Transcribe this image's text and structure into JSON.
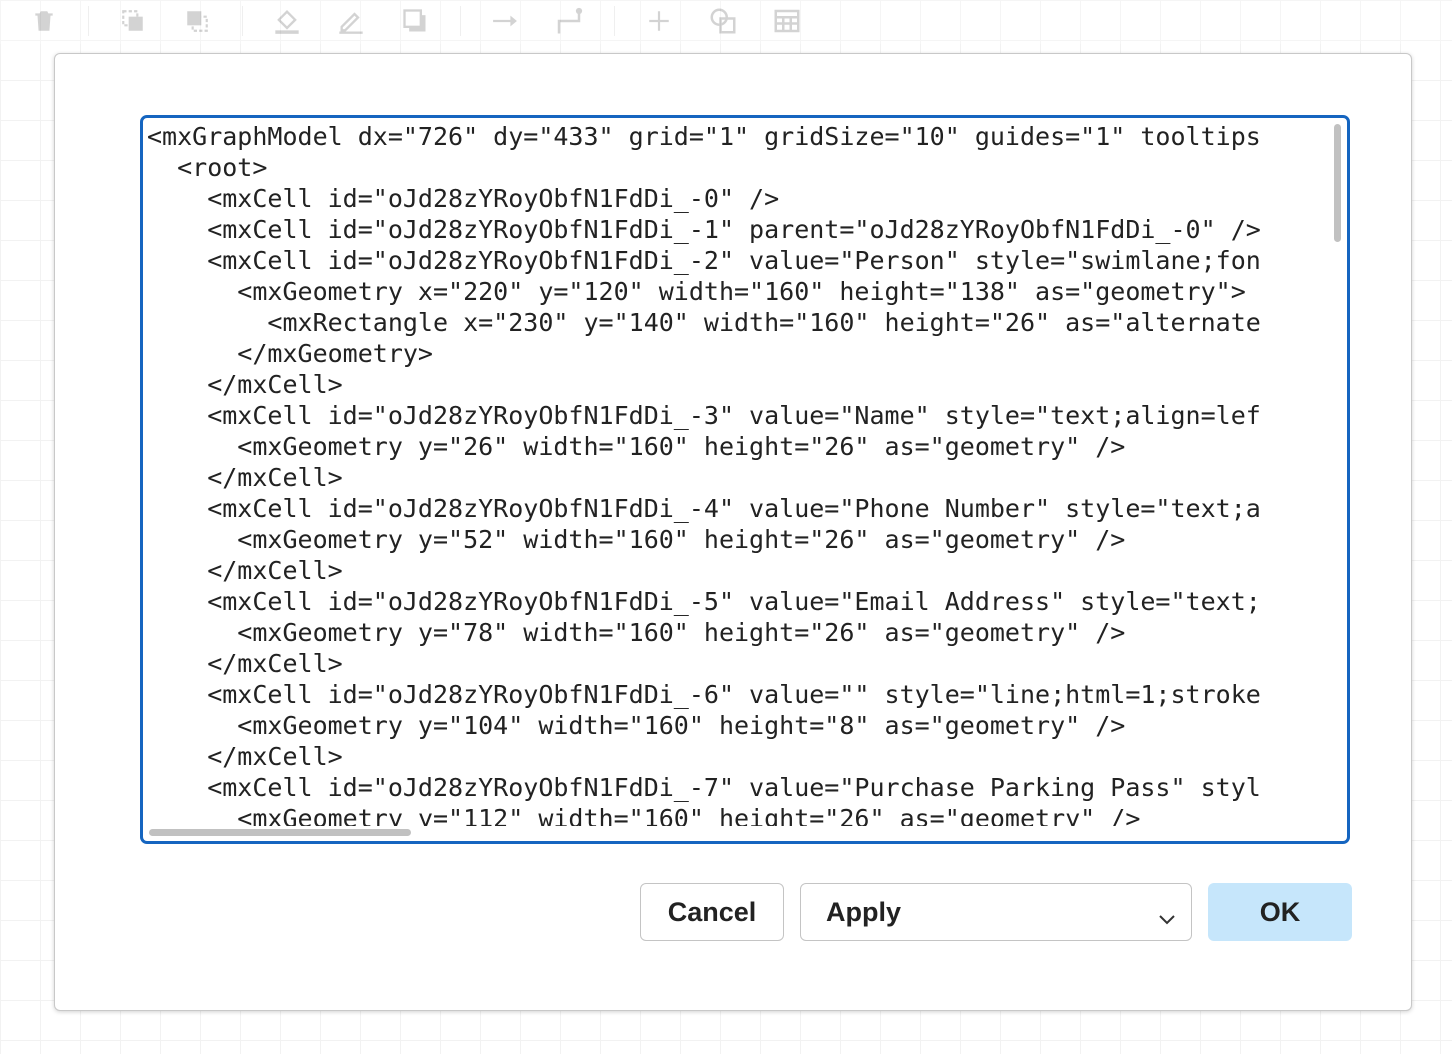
{
  "toolbar": {
    "icons": [
      "delete-icon",
      "to-front-icon",
      "to-back-icon",
      "fill-color-icon",
      "line-color-icon",
      "shadow-icon",
      "connection-icon",
      "waypoints-icon",
      "insert-icon",
      "shapes-icon",
      "table-icon"
    ]
  },
  "editor": {
    "lines": [
      "<mxGraphModel dx=\"726\" dy=\"433\" grid=\"1\" gridSize=\"10\" guides=\"1\" tooltips",
      "  <root>",
      "    <mxCell id=\"oJd28zYRoyObfN1FdDi_-0\" />",
      "    <mxCell id=\"oJd28zYRoyObfN1FdDi_-1\" parent=\"oJd28zYRoyObfN1FdDi_-0\" />",
      "    <mxCell id=\"oJd28zYRoyObfN1FdDi_-2\" value=\"Person\" style=\"swimlane;fon",
      "      <mxGeometry x=\"220\" y=\"120\" width=\"160\" height=\"138\" as=\"geometry\">",
      "        <mxRectangle x=\"230\" y=\"140\" width=\"160\" height=\"26\" as=\"alternate",
      "      </mxGeometry>",
      "    </mxCell>",
      "    <mxCell id=\"oJd28zYRoyObfN1FdDi_-3\" value=\"Name\" style=\"text;align=lef",
      "      <mxGeometry y=\"26\" width=\"160\" height=\"26\" as=\"geometry\" />",
      "    </mxCell>",
      "    <mxCell id=\"oJd28zYRoyObfN1FdDi_-4\" value=\"Phone Number\" style=\"text;a",
      "      <mxGeometry y=\"52\" width=\"160\" height=\"26\" as=\"geometry\" />",
      "    </mxCell>",
      "    <mxCell id=\"oJd28zYRoyObfN1FdDi_-5\" value=\"Email Address\" style=\"text;",
      "      <mxGeometry y=\"78\" width=\"160\" height=\"26\" as=\"geometry\" />",
      "    </mxCell>",
      "    <mxCell id=\"oJd28zYRoyObfN1FdDi_-6\" value=\"\" style=\"line;html=1;stroke",
      "      <mxGeometry y=\"104\" width=\"160\" height=\"8\" as=\"geometry\" />",
      "    </mxCell>",
      "    <mxCell id=\"oJd28zYRoyObfN1FdDi_-7\" value=\"Purchase Parking Pass\" styl",
      "      <mxGeometry y=\"112\" width=\"160\" height=\"26\" as=\"geometry\" />"
    ]
  },
  "buttons": {
    "cancel_label": "Cancel",
    "apply_label": "Apply",
    "ok_label": "OK"
  },
  "colors": {
    "accent_border": "#1565c0",
    "ok_background": "#c6e6fb"
  }
}
